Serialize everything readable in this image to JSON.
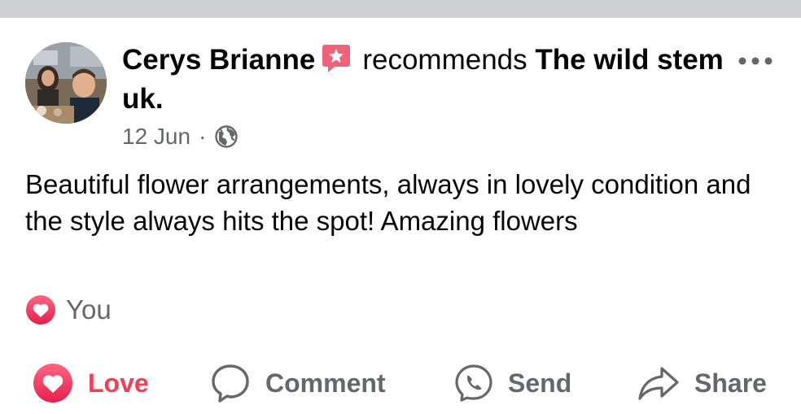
{
  "post": {
    "author_name": "Cerys Brianne",
    "recommends_label": "recommends",
    "page_name": "The wild stem uk.",
    "date": "12 Jun",
    "separator": "·",
    "audience_icon": "globe-icon",
    "recommendation_badge_icon": "star-speech-bubble-icon",
    "text": "Beautiful flower arrangements, always in lovely condition and the style always hits the spot! Amazing flowers"
  },
  "reactions": {
    "icon": "heart-icon",
    "label": "You"
  },
  "actions": {
    "love_label": "Love",
    "comment_label": "Comment",
    "send_label": "Send",
    "share_label": "Share"
  },
  "colors": {
    "love_accent": "#f33e58",
    "secondary_text": "#65676b",
    "divider": "#ced0d4"
  }
}
